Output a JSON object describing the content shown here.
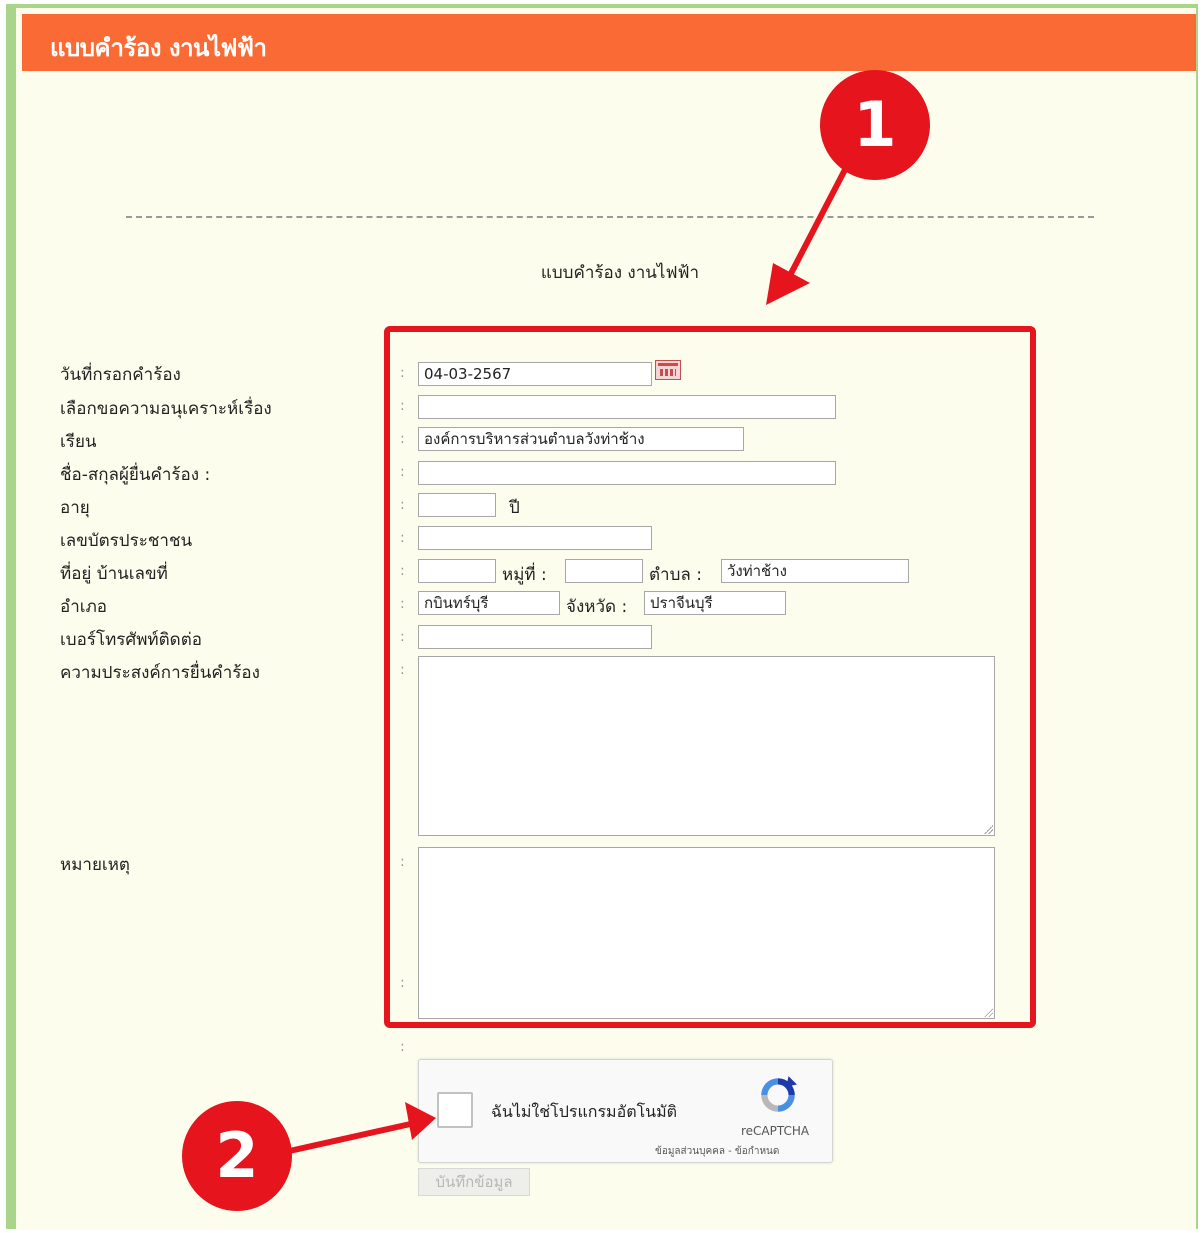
{
  "header": {
    "title": "แบบคำร้อง งานไฟฟ้า"
  },
  "form": {
    "title": "แบบคำร้อง งานไฟฟ้า",
    "labels": {
      "date": "วันที่กรอกคำร้อง",
      "topic": "เลือกขอความอนุเคราะห์เรื่อง",
      "to": "เรียน",
      "name": "ชื่อ-สกุลผู้ยื่นคำร้อง :",
      "age": "อายุ",
      "id_card": "เลขบัตรประชาชน",
      "address": "ที่อยู่ บ้านเลขที่",
      "district": "อำเภอ",
      "phone": "เบอร์โทรศัพท์ติดต่อ",
      "purpose": "ความประสงค์การยื่นคำร้อง",
      "note": "หมายเหตุ",
      "age_unit": "ปี",
      "moo": "หมู่ที่ :",
      "tambon": "ตำบล :",
      "province": "จังหวัด :",
      "colon": ":"
    },
    "values": {
      "date": "04-03-2567",
      "topic": "",
      "to": "องค์การบริหารส่วนตำบลวังท่าช้าง",
      "name": "",
      "age": "",
      "id_card": "",
      "house_no": "",
      "moo": "",
      "tambon": "วังท่าช้าง",
      "district": "กบินทร์บุรี",
      "province": "ปราจีนบุรี",
      "phone": "",
      "purpose": "",
      "note": ""
    }
  },
  "captcha": {
    "label": "ฉันไม่ใช่โปรแกรมอัตโนมัติ",
    "brand": "reCAPTCHA",
    "links": "ข้อมูลส่วนบุคคล - ข้อกำหนด"
  },
  "buttons": {
    "save_label": "บันทึกข้อมูล"
  },
  "annotations": {
    "badge1": "1",
    "badge2": "2"
  },
  "colors": {
    "header": "#f96a35",
    "background": "#fdfdee",
    "border_green": "#a9d58a",
    "highlight_red": "#e5141d"
  }
}
